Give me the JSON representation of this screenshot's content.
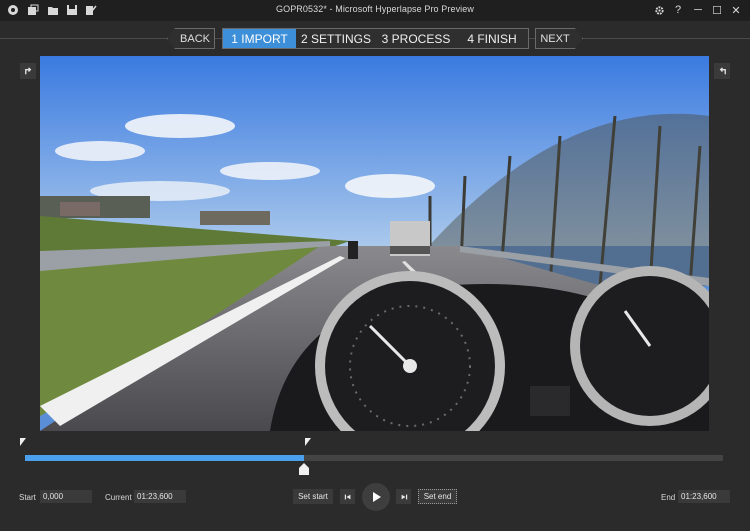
{
  "titlebar": {
    "title": "GOPR0532* - Microsoft Hyperlapse Pro Preview",
    "icons": [
      "app-logo-icon",
      "new-project-icon",
      "open-folder-icon",
      "save-icon",
      "save-as-icon"
    ],
    "window_controls": {
      "minimize": "─",
      "maximize": "☐",
      "close": "✕",
      "help": "?"
    }
  },
  "nav": {
    "back_label": "BACK",
    "next_label": "NEXT",
    "steps": [
      {
        "label": "1 IMPORT",
        "active": true
      },
      {
        "label": "2 SETTINGS",
        "active": false
      },
      {
        "label": "3 PROCESS",
        "active": false
      },
      {
        "label": "4 FINISH",
        "active": false
      }
    ]
  },
  "timeline": {
    "progress_fraction": 0.4,
    "start_marker_fraction": 0.0,
    "end_marker_fraction": 0.4
  },
  "controls": {
    "start_label": "Start",
    "start_value": "0,000",
    "current_label": "Current",
    "current_value": "01:23,600",
    "set_start_label": "Set start",
    "set_end_label": "Set end",
    "end_label": "End",
    "end_value": "01:23,600"
  },
  "colors": {
    "accent": "#3c8fd8",
    "progress": "#4aa0ec",
    "background": "#2b2b2b"
  }
}
